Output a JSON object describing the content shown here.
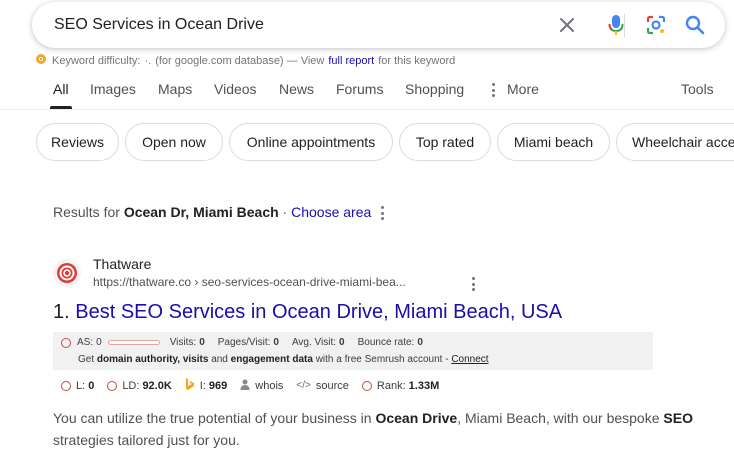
{
  "search": {
    "query": "SEO Services in Ocean Drive"
  },
  "keyword_line": {
    "prefix": "Keyword difficulty:",
    "value": "·.",
    "middle": "(for google.com database) — View",
    "link": "full report",
    "suffix": "for this keyword"
  },
  "tabs": [
    {
      "label": "All"
    },
    {
      "label": "Images"
    },
    {
      "label": "Maps"
    },
    {
      "label": "Videos"
    },
    {
      "label": "News"
    },
    {
      "label": "Forums"
    },
    {
      "label": "Shopping"
    },
    {
      "label": "More"
    },
    {
      "label": "Tools"
    }
  ],
  "chips": [
    {
      "label": "Reviews"
    },
    {
      "label": "Open now"
    },
    {
      "label": "Online appointments"
    },
    {
      "label": "Top rated"
    },
    {
      "label": "Miami beach"
    },
    {
      "label": "Wheelchair acce"
    }
  ],
  "results_for": {
    "prefix": "Results for",
    "location": "Ocean Dr, Miami Beach",
    "separator": "·",
    "choose": "Choose area"
  },
  "result": {
    "site_name": "Thatware",
    "url": "https://thatware.co › seo-services-ocean-drive-miami-bea...",
    "number": "1.",
    "title": "Best SEO Services in Ocean Drive, Miami Beach, USA",
    "semrush": {
      "as_label": "AS:",
      "as_value": "0",
      "visits_label": "Visits:",
      "visits_value": "0",
      "pages_label": "Pages/Visit:",
      "pages_value": "0",
      "avg_label": "Avg. Visit:",
      "avg_value": "0",
      "bounce_label": "Bounce rate:",
      "bounce_value": "0",
      "cta_get": "Get",
      "cta_b1": "domain authority, visits",
      "cta_and": "and",
      "cta_b2": "engagement data",
      "cta_rest": "with a free Semrush account -",
      "cta_link": "Connect"
    },
    "metrics": {
      "l_label": "L:",
      "l_value": "0",
      "ld_label": "LD:",
      "ld_value": "92.0K",
      "i_label": "I:",
      "i_value": "969",
      "whois": "whois",
      "source": "source",
      "rank_label": "Rank:",
      "rank_value": "1.33M"
    },
    "snippet": {
      "s1": "You can utilize the true potential of your business in",
      "b1": "Ocean Drive",
      "s2": ", Miami Beach, with our bespoke",
      "b2": "SEO",
      "s3": "strategies tailored just for you."
    }
  },
  "colors": {
    "link": "#1a0dab",
    "semrush_accent": "#c0533a",
    "bing_orange": "#f5a623"
  }
}
